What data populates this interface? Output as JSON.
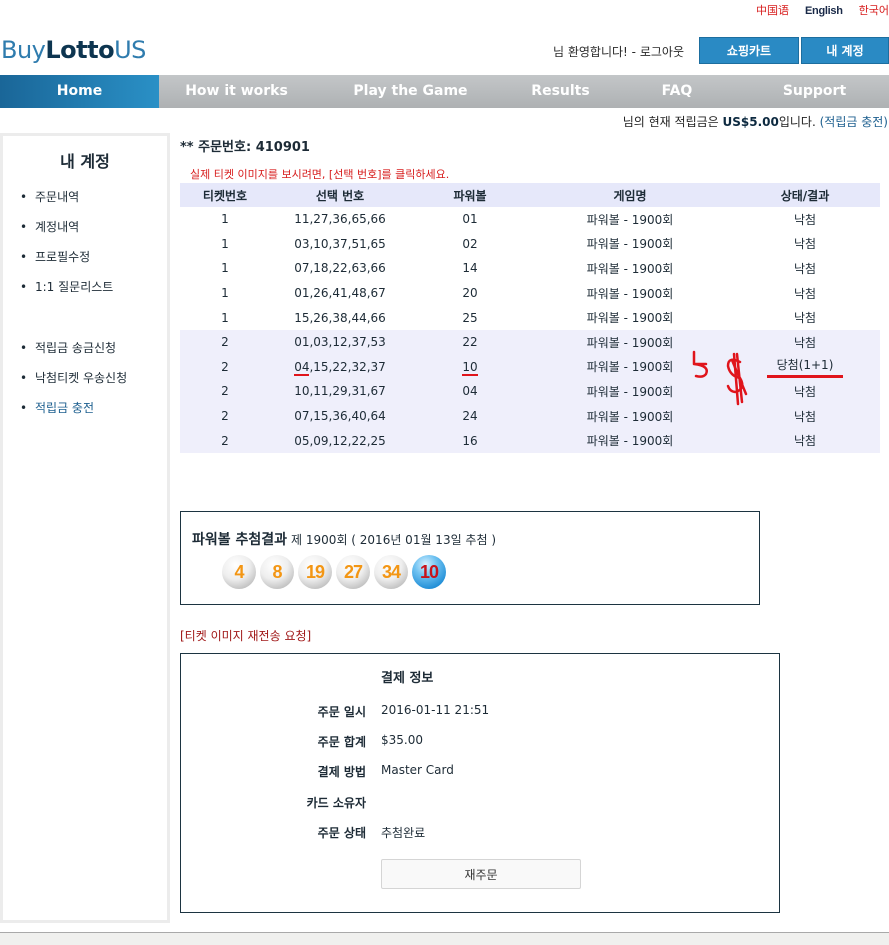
{
  "languages": [
    "中国语",
    "English",
    "한국어"
  ],
  "logo": {
    "part1": "Buy",
    "part2": "Lotto",
    "part3": "US"
  },
  "header": {
    "welcome_text": "님 환영합니다! - 로그아웃",
    "cart_button": "쇼핑카트",
    "account_button": "내 계정"
  },
  "nav": [
    "Home",
    "How it works",
    "Play the Game",
    "Results",
    "FAQ",
    "Support"
  ],
  "balance": {
    "prefix": "님의 현재 적립금은 ",
    "amount": "US$5.00",
    "suffix": "입니다.",
    "charge_link": "(적립금 충전)"
  },
  "sidebar": {
    "title": "내 계정",
    "items": [
      "주문내역",
      "계정내역",
      "프로필수정",
      "1:1 질문리스트",
      "적립금 송금신청",
      "낙첨티켓 우송신청",
      "적립금 충전"
    ]
  },
  "order": {
    "label": "** 주문번호: ",
    "number": "410901",
    "notice": "실제 티켓 이미지를 보시려면, [선택 번호]를 클릭하세요."
  },
  "table": {
    "headers": [
      "티켓번호",
      "선택 번호",
      "파워볼",
      "게임명",
      "상태/결과"
    ],
    "rows": [
      {
        "ticket": "1",
        "numbers": "11,27,36,65,66",
        "powerball": "01",
        "game": "파워볼 - 1900회",
        "status": "낙첨"
      },
      {
        "ticket": "1",
        "numbers": "03,10,37,51,65",
        "powerball": "02",
        "game": "파워볼 - 1900회",
        "status": "낙첨"
      },
      {
        "ticket": "1",
        "numbers": "07,18,22,63,66",
        "powerball": "14",
        "game": "파워볼 - 1900회",
        "status": "낙첨"
      },
      {
        "ticket": "1",
        "numbers": "01,26,41,48,67",
        "powerball": "20",
        "game": "파워볼 - 1900회",
        "status": "낙첨"
      },
      {
        "ticket": "1",
        "numbers": "15,26,38,44,66",
        "powerball": "25",
        "game": "파워볼 - 1900회",
        "status": "낙첨"
      },
      {
        "ticket": "2",
        "numbers": "01,03,12,37,53",
        "powerball": "22",
        "game": "파워볼 - 1900회",
        "status": "낙첨"
      },
      {
        "ticket": "2",
        "numbers_first": "04",
        "numbers_rest": ",15,22,32,37",
        "powerball": "10",
        "game": "파워볼 - 1900회",
        "status": "당첨(1+1)"
      },
      {
        "ticket": "2",
        "numbers": "10,11,29,31,67",
        "powerball": "04",
        "game": "파워볼 - 1900회",
        "status": "낙첨"
      },
      {
        "ticket": "2",
        "numbers": "07,15,36,40,64",
        "powerball": "24",
        "game": "파워볼 - 1900회",
        "status": "낙첨"
      },
      {
        "ticket": "2",
        "numbers": "05,09,12,22,25",
        "powerball": "16",
        "game": "파워볼 - 1900회",
        "status": "낙첨"
      }
    ]
  },
  "annotation": {
    "text": "5$",
    "color": "#e0141b"
  },
  "draw_result": {
    "title": "파워볼 추첨결과",
    "subtitle": "제 1900회 ( 2016년 01월 13일 추첨 )",
    "white_balls": [
      "4",
      "8",
      "19",
      "27",
      "34"
    ],
    "powerball": "10"
  },
  "resend_link": "[티켓 이미지 재전송 요청]",
  "payment": {
    "title": "결제 정보",
    "rows": [
      {
        "label": "주문 일시",
        "value": "2016-01-11 21:51"
      },
      {
        "label": "주문 합계",
        "value": "$35.00"
      },
      {
        "label": "결제 방법",
        "value": "Master Card"
      },
      {
        "label": "카드 소유자",
        "value": ""
      },
      {
        "label": "주문 상태",
        "value": "추첨완료"
      }
    ],
    "reorder_button": "재주문"
  }
}
